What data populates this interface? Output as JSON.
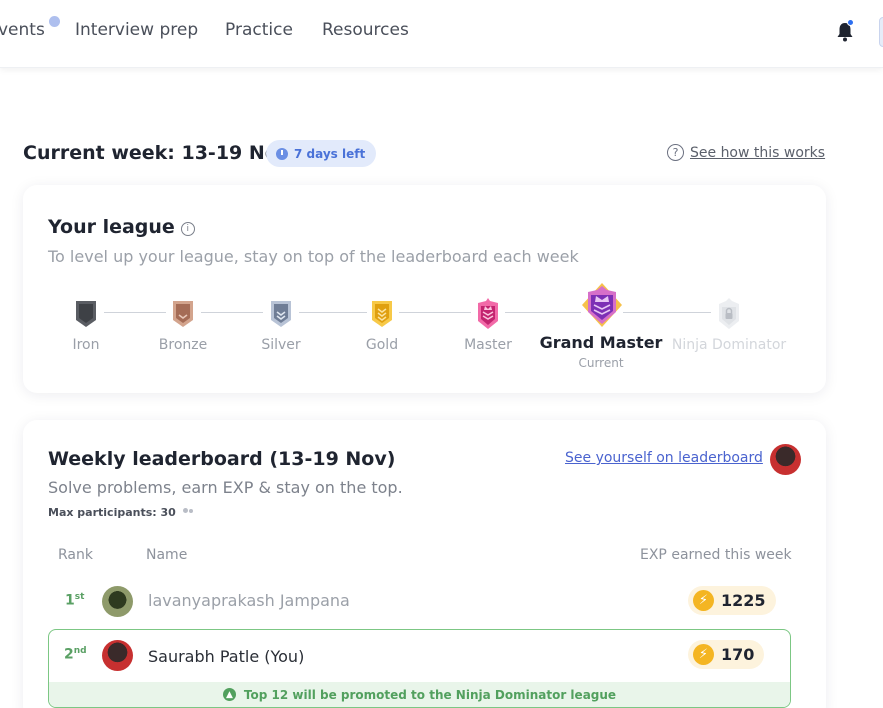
{
  "nav": {
    "items": [
      "vents",
      "Interview prep",
      "Practice",
      "Resources"
    ]
  },
  "header": {
    "week_title": "Current week: 13-19 Nov",
    "days_left": "7 days left",
    "how_link": "See how this works"
  },
  "league": {
    "title": "Your league",
    "subtitle": "To level up your league, stay on top of the leaderboard each week",
    "tiers": [
      {
        "name": "Iron",
        "color": "#5a5d63"
      },
      {
        "name": "Bronze",
        "color": "#b9826a"
      },
      {
        "name": "Silver",
        "color": "#8e9bb2"
      },
      {
        "name": "Gold",
        "color": "#f2b01d"
      },
      {
        "name": "Master",
        "color": "#e03b8f"
      },
      {
        "name": "Grand Master",
        "color": "#8d3fc8"
      },
      {
        "name": "Ninja Dominator",
        "color": "#d8dbe0"
      }
    ],
    "current_tag": "Current"
  },
  "leaderboard": {
    "title": "Weekly leaderboard (13-19 Nov)",
    "subtitle": "Solve problems, earn EXP & stay on the top.",
    "see_link": "See yourself on leaderboard",
    "max_participants": "Max participants: 30",
    "columns": {
      "rank": "Rank",
      "name": "Name",
      "exp": "EXP earned this week"
    },
    "rows": [
      {
        "rank": "1",
        "suffix": "st",
        "name": "lavanyaprakash Jampana",
        "exp": "1225"
      },
      {
        "rank": "2",
        "suffix": "nd",
        "name": "Saurabh Patle (You)",
        "exp": "170"
      }
    ],
    "promo": "Top 12 will be promoted to the Ninja Dominator league"
  }
}
